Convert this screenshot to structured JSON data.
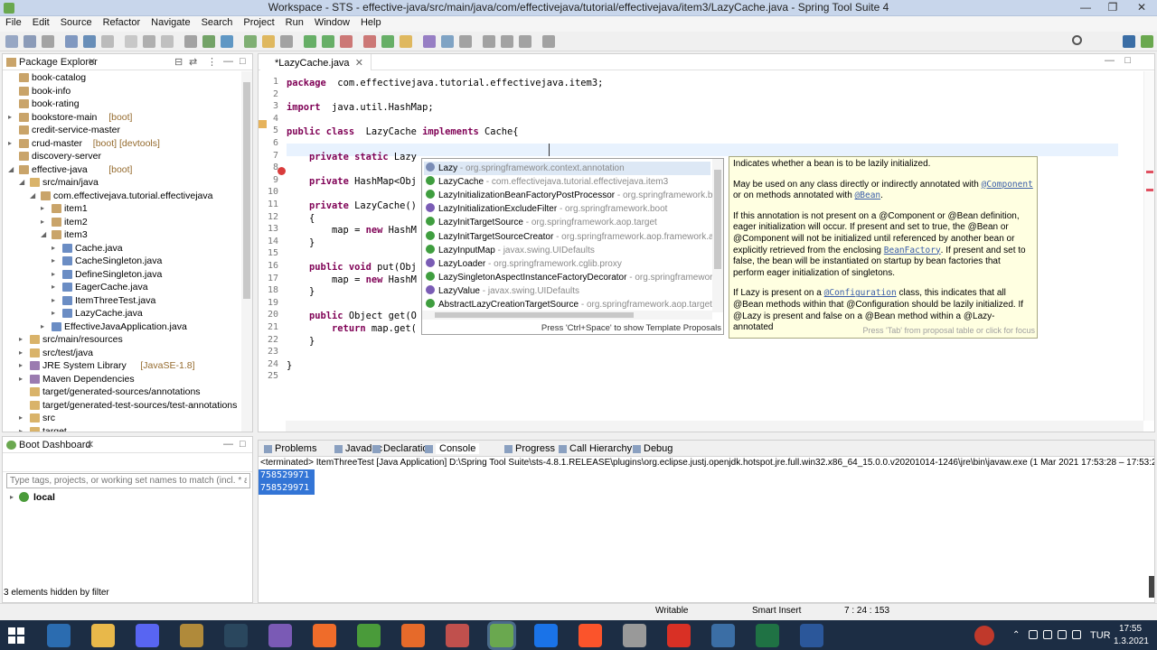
{
  "window": {
    "title": "Workspace - STS - effective-java/src/main/java/com/effectivejava/tutorial/effectivejava/item3/LazyCache.java - Spring Tool Suite 4"
  },
  "menu": [
    "File",
    "Edit",
    "Source",
    "Refactor",
    "Navigate",
    "Search",
    "Project",
    "Run",
    "Window",
    "Help"
  ],
  "package_explorer": {
    "title": "Package Explorer",
    "items": [
      {
        "label": "book-catalog",
        "deco": "",
        "depth": 0,
        "tw": ""
      },
      {
        "label": "book-info",
        "deco": "",
        "depth": 0,
        "tw": ""
      },
      {
        "label": "book-rating",
        "deco": "",
        "depth": 0,
        "tw": ""
      },
      {
        "label": "bookstore-main",
        "deco": "[boot]",
        "depth": 0,
        "tw": ">"
      },
      {
        "label": "credit-service-master",
        "deco": "",
        "depth": 0,
        "tw": ""
      },
      {
        "label": "crud-master",
        "deco": "[boot] [devtools]",
        "depth": 0,
        "tw": ">"
      },
      {
        "label": "discovery-server",
        "deco": "",
        "depth": 0,
        "tw": ""
      },
      {
        "label": "effective-java",
        "deco": "[boot]",
        "depth": 0,
        "tw": "v"
      },
      {
        "label": "src/main/java",
        "deco": "",
        "depth": 1,
        "tw": "v"
      },
      {
        "label": "com.effectivejava.tutorial.effectivejava",
        "deco": "",
        "depth": 2,
        "tw": "v"
      },
      {
        "label": "item1",
        "deco": "",
        "depth": 3,
        "tw": ">"
      },
      {
        "label": "item2",
        "deco": "",
        "depth": 3,
        "tw": ">"
      },
      {
        "label": "item3",
        "deco": "",
        "depth": 3,
        "tw": "v"
      },
      {
        "label": "Cache.java",
        "deco": "",
        "depth": 4,
        "tw": ">"
      },
      {
        "label": "CacheSingleton.java",
        "deco": "",
        "depth": 4,
        "tw": ">"
      },
      {
        "label": "DefineSingleton.java",
        "deco": "",
        "depth": 4,
        "tw": ">"
      },
      {
        "label": "EagerCache.java",
        "deco": "",
        "depth": 4,
        "tw": ">"
      },
      {
        "label": "ItemThreeTest.java",
        "deco": "",
        "depth": 4,
        "tw": ">"
      },
      {
        "label": "LazyCache.java",
        "deco": "",
        "depth": 4,
        "tw": ">"
      },
      {
        "label": "EffectiveJavaApplication.java",
        "deco": "",
        "depth": 3,
        "tw": ">"
      },
      {
        "label": "src/main/resources",
        "deco": "",
        "depth": 1,
        "tw": ">"
      },
      {
        "label": "src/test/java",
        "deco": "",
        "depth": 1,
        "tw": ">"
      },
      {
        "label": "JRE System Library",
        "deco": "[JavaSE-1.8]",
        "depth": 1,
        "tw": ">"
      },
      {
        "label": "Maven Dependencies",
        "deco": "",
        "depth": 1,
        "tw": ">"
      },
      {
        "label": "target/generated-sources/annotations",
        "deco": "",
        "depth": 1,
        "tw": ""
      },
      {
        "label": "target/generated-test-sources/test-annotations",
        "deco": "",
        "depth": 1,
        "tw": ""
      },
      {
        "label": "src",
        "deco": "",
        "depth": 1,
        "tw": ">"
      },
      {
        "label": "target",
        "deco": "",
        "depth": 1,
        "tw": ">"
      }
    ]
  },
  "editor": {
    "tab": "*LazyCache.java",
    "lines": [
      {
        "n": "1",
        "code": [
          [
            "kw",
            "package"
          ],
          [
            "",
            "  com.effectivejava.tutorial.effectivejava.item3;"
          ]
        ]
      },
      {
        "n": "2",
        "code": []
      },
      {
        "n": "3",
        "code": [
          [
            "kw",
            "import"
          ],
          [
            "",
            "  java.util.HashMap;"
          ]
        ]
      },
      {
        "n": "4",
        "code": []
      },
      {
        "n": "5",
        "code": [
          [
            "kw",
            "public class"
          ],
          [
            "",
            "  LazyCache "
          ],
          [
            "kw",
            "implements"
          ],
          [
            "",
            " Cache{"
          ]
        ]
      },
      {
        "n": "6",
        "code": []
      },
      {
        "n": "7",
        "code": [
          [
            "",
            "    "
          ],
          [
            "kw",
            "private static"
          ],
          [
            "",
            " Lazy"
          ]
        ]
      },
      {
        "n": "8",
        "code": []
      },
      {
        "n": "9",
        "code": [
          [
            "",
            "    "
          ],
          [
            "kw",
            "private"
          ],
          [
            "",
            " HashMap<Obj"
          ]
        ]
      },
      {
        "n": "10",
        "code": []
      },
      {
        "n": "11",
        "code": [
          [
            "",
            "    "
          ],
          [
            "kw",
            "private"
          ],
          [
            "",
            " LazyCache()"
          ]
        ]
      },
      {
        "n": "12",
        "code": [
          [
            "",
            "    {"
          ]
        ]
      },
      {
        "n": "13",
        "code": [
          [
            "",
            "        map = "
          ],
          [
            "kw",
            "new"
          ],
          [
            "",
            " HashM"
          ]
        ]
      },
      {
        "n": "14",
        "code": [
          [
            "",
            "    }"
          ]
        ]
      },
      {
        "n": "15",
        "code": []
      },
      {
        "n": "16",
        "code": [
          [
            "",
            "    "
          ],
          [
            "kw",
            "public void"
          ],
          [
            "",
            " put(Obj"
          ]
        ]
      },
      {
        "n": "17",
        "code": [
          [
            "",
            "        map = "
          ],
          [
            "kw",
            "new"
          ],
          [
            "",
            " HashM"
          ]
        ]
      },
      {
        "n": "18",
        "code": [
          [
            "",
            "    }"
          ]
        ]
      },
      {
        "n": "19",
        "code": []
      },
      {
        "n": "20",
        "code": [
          [
            "",
            "    "
          ],
          [
            "kw",
            "public"
          ],
          [
            "",
            " Object get(O"
          ]
        ]
      },
      {
        "n": "21",
        "code": [
          [
            "",
            "        "
          ],
          [
            "kw",
            "return"
          ],
          [
            "",
            " map.get("
          ]
        ]
      },
      {
        "n": "22",
        "code": [
          [
            "",
            "    }"
          ]
        ]
      },
      {
        "n": "23",
        "code": []
      },
      {
        "n": "24",
        "code": [
          [
            "",
            "}"
          ]
        ]
      },
      {
        "n": "25",
        "code": []
      }
    ]
  },
  "proposals": {
    "items": [
      {
        "name": "Lazy",
        "qual": " - org.springframework.context.annotation",
        "color": "#7a8cb5"
      },
      {
        "name": "LazyCache",
        "qual": " - com.effectivejava.tutorial.effectivejava.item3",
        "color": "#3f9e3f"
      },
      {
        "name": "LazyInitializationBeanFactoryPostProcessor",
        "qual": " - org.springframework.boot",
        "color": "#3f9e3f"
      },
      {
        "name": "LazyInitializationExcludeFilter",
        "qual": " - org.springframework.boot",
        "color": "#7a5cb5"
      },
      {
        "name": "LazyInitTargetSource",
        "qual": " - org.springframework.aop.target",
        "color": "#3f9e3f"
      },
      {
        "name": "LazyInitTargetSourceCreator",
        "qual": " - org.springframework.aop.framework.aut",
        "color": "#3f9e3f"
      },
      {
        "name": "LazyInputMap",
        "qual": " - javax.swing.UIDefaults",
        "color": "#3f9e3f"
      },
      {
        "name": "LazyLoader",
        "qual": " - org.springframework.cglib.proxy",
        "color": "#7a5cb5"
      },
      {
        "name": "LazySingletonAspectInstanceFactoryDecorator",
        "qual": " - org.springframework.aop",
        "color": "#3f9e3f"
      },
      {
        "name": "LazyValue",
        "qual": " - javax.swing.UIDefaults",
        "color": "#7a5cb5"
      },
      {
        "name": "AbstractLazyCreationTargetSource",
        "qual": " - org.springframework.aop.target",
        "color": "#3f9e3f"
      }
    ],
    "footer": "Press 'Ctrl+Space' to show Template Proposals"
  },
  "doc": {
    "p1": "Indicates whether a bean is to be lazily initialized.",
    "p2a": "May be used on any class directly or indirectly annotated with ",
    "p2b": "@Component",
    "p2c": " or on methods annotated with ",
    "p2d": "@Bean",
    "p2e": ".",
    "p3": "If this annotation is not present on a @Component or @Bean definition, eager initialization will occur. If present and set to true, the @Bean or @Component will not be initialized until referenced by another bean or explicitly retrieved from the enclosing ",
    "p3b": "BeanFactory",
    "p3c": ". If present and set to false, the bean will be instantiated on startup by bean factories that perform eager initialization of singletons.",
    "p4a": "If Lazy is present on a ",
    "p4b": "@Configuration",
    "p4c": " class, this indicates that all @Bean methods within that @Configuration should be lazily initialized. If @Lazy is present and false on a @Bean method within a @Lazy-annotated",
    "foot": "Press 'Tab' from proposal table or click for focus"
  },
  "boot_dashboard": {
    "title": "Boot Dashboard",
    "filter_placeholder": "Type tags, projects, or working set names to match (incl. * and",
    "item": "local",
    "hidden": "3 elements hidden by filter"
  },
  "console": {
    "tabs": [
      "Problems",
      "Javadoc",
      "Declaration",
      "Console",
      "Progress",
      "Call Hierarchy",
      "Debug"
    ],
    "header": "<terminated> ItemThreeTest [Java Application] D:\\Spring Tool Suite\\sts-4.8.1.RELEASE\\plugins\\org.eclipse.justj.openjdk.hotspot.jre.full.win32.x86_64_15.0.0.v20201014-1246\\jre\\bin\\javaw.exe  (1 Mar 2021 17:53:28 – 17:53:29)",
    "output": [
      "758529971",
      "758529971"
    ]
  },
  "status": {
    "writable": "Writable",
    "insert": "Smart Insert",
    "pos": "7 : 24 : 153"
  },
  "taskbar": {
    "lang": "TUR",
    "time": "17:55",
    "date": "1.3.2021"
  }
}
